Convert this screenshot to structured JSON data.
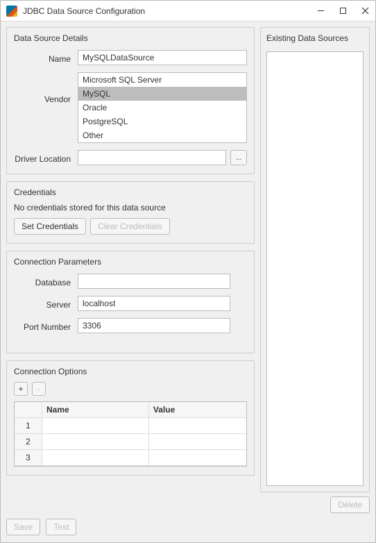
{
  "window": {
    "title": "JDBC Data Source Configuration"
  },
  "groups": {
    "details": {
      "title": "Data Source Details"
    },
    "credentials": {
      "title": "Credentials"
    },
    "connection": {
      "title": "Connection Parameters"
    },
    "options": {
      "title": "Connection Options"
    },
    "existing": {
      "title": "Existing Data Sources"
    }
  },
  "details": {
    "name_label": "Name",
    "name_value": "MySQLDataSource",
    "vendor_label": "Vendor",
    "vendors": [
      "Microsoft SQL Server",
      "MySQL",
      "Oracle",
      "PostgreSQL",
      "Other"
    ],
    "vendor_selected": "MySQL",
    "driver_label": "Driver Location",
    "driver_value": "",
    "browse_label": "..."
  },
  "credentials": {
    "message": "No credentials stored for this data source",
    "set_label": "Set Credentials",
    "clear_label": "Clear Credentials"
  },
  "connection": {
    "database_label": "Database",
    "database_value": "",
    "server_label": "Server",
    "server_value": "localhost",
    "port_label": "Port Number",
    "port_value": "3306"
  },
  "options": {
    "add_label": "+",
    "remove_label": "-",
    "columns": {
      "name": "Name",
      "value": "Value"
    },
    "rows": [
      {
        "num": "1",
        "name": "",
        "value": ""
      },
      {
        "num": "2",
        "name": "",
        "value": ""
      },
      {
        "num": "3",
        "name": "",
        "value": ""
      }
    ]
  },
  "existing": {
    "delete_label": "Delete"
  },
  "actions": {
    "save_label": "Save",
    "test_label": "Test"
  }
}
